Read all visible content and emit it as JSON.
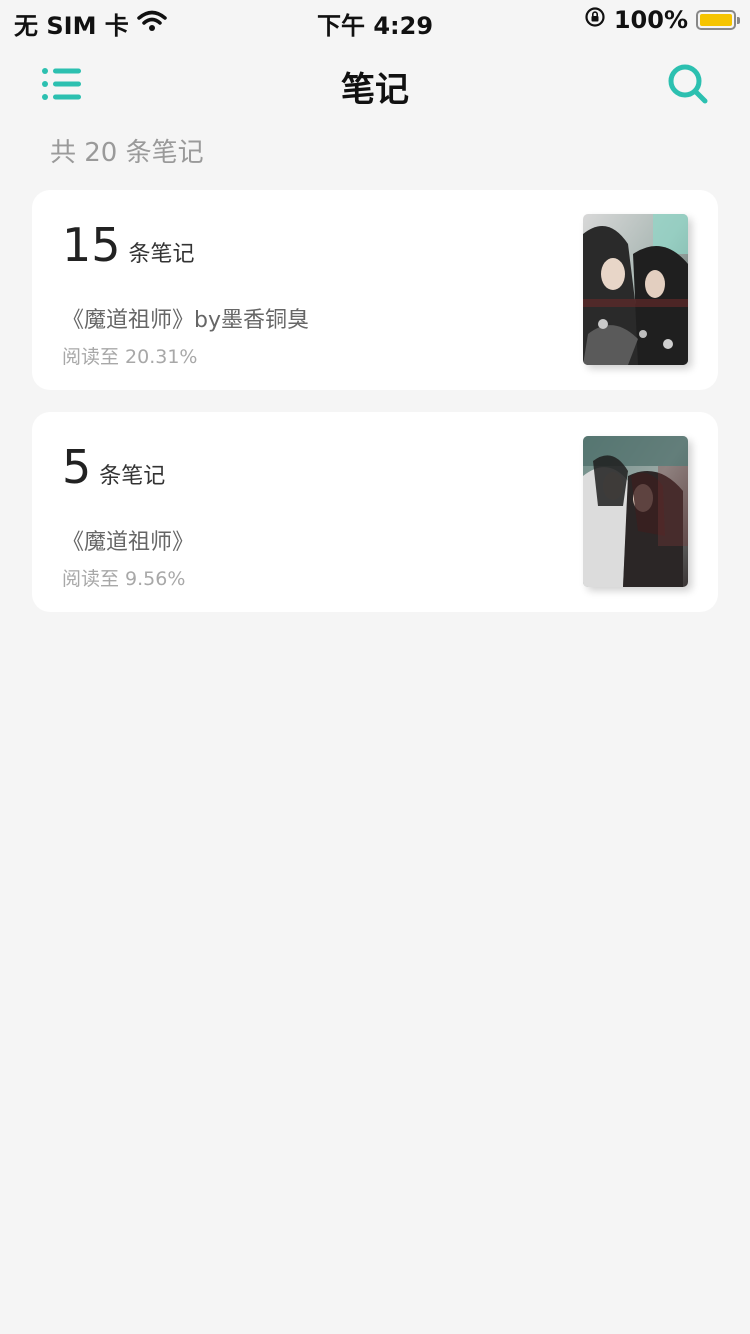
{
  "status_bar": {
    "carrier": "无 SIM 卡",
    "time": "下午 4:29",
    "battery": "100%"
  },
  "nav": {
    "title": "笔记"
  },
  "summary": {
    "total_text": "共 20 条笔记"
  },
  "notes": [
    {
      "count": "15",
      "count_label": "条笔记",
      "book_title": "《魔道祖师》by墨香铜臭",
      "progress": "阅读至 20.31%"
    },
    {
      "count": "5",
      "count_label": "条笔记",
      "book_title": "《魔道祖师》",
      "progress": "阅读至 9.56%"
    }
  ],
  "colors": {
    "accent": "#2cc0b0",
    "background": "#f5f5f5",
    "battery": "#f5c400"
  },
  "icons": {
    "menu": "list-menu-icon",
    "search": "search-icon",
    "wifi": "wifi-icon",
    "lock": "orientation-lock-icon",
    "battery": "battery-icon"
  }
}
